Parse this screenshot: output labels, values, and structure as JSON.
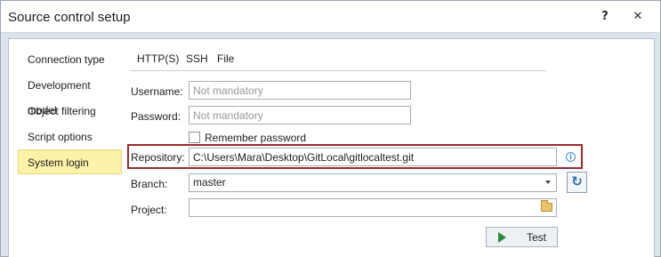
{
  "window": {
    "title": "Source control setup",
    "help_label": "?",
    "close_label": "✕"
  },
  "sidebar": {
    "items": [
      {
        "label": "Connection type"
      },
      {
        "label": "Development model"
      },
      {
        "label": "Object filtering"
      },
      {
        "label": "Script options"
      },
      {
        "label": "System login",
        "active": true
      }
    ]
  },
  "tabs": [
    {
      "label": "HTTP(S)"
    },
    {
      "label": "SSH"
    },
    {
      "label": "File",
      "selected": true
    }
  ],
  "form": {
    "username": {
      "label": "Username:",
      "value": "",
      "placeholder": "Not mandatory"
    },
    "password": {
      "label": "Password:",
      "value": "",
      "placeholder": "Not mandatory"
    },
    "remember": {
      "label": "Remember password",
      "checked": false
    },
    "repository": {
      "label": "Repository:",
      "value": "C:\\Users\\Mara\\Desktop\\GitLocal\\gitlocaltest.git"
    },
    "branch": {
      "label": "Branch:",
      "value": "master"
    },
    "project": {
      "label": "Project:",
      "value": ""
    }
  },
  "actions": {
    "test_label": "Test",
    "info_label": "i",
    "refresh_label": "↻"
  },
  "colors": {
    "highlight_border": "#9d2b32",
    "active_nav_bg": "#fcf2a8",
    "window_bg": "#dbe3ec",
    "play_green": "#2e8b3a",
    "info_blue": "#3d8fd8"
  }
}
